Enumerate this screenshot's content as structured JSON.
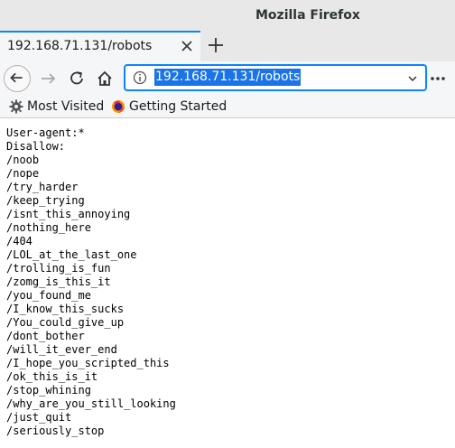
{
  "window": {
    "title": "Mozilla Firefox"
  },
  "tabs": [
    {
      "title": "192.168.71.131/robots"
    }
  ],
  "navbar": {
    "url": "192.168.71.131/robots"
  },
  "bookmarks": [
    {
      "label": "Most Visited",
      "icon": "gear-icon"
    },
    {
      "label": "Getting Started",
      "icon": "firefox-icon"
    }
  ],
  "content": {
    "lines": [
      "User-agent:*",
      "Disallow:",
      "/noob",
      "/nope",
      "/try_harder",
      "/keep_trying",
      "/isnt_this_annoying",
      "/nothing_here",
      "/404",
      "/LOL_at_the_last_one",
      "/trolling_is_fun",
      "/zomg_is_this_it",
      "/you_found_me",
      "/I_know_this_sucks",
      "/You_could_give_up",
      "/dont_bother",
      "/will_it_ever_end",
      "/I_hope_you_scripted_this",
      "/ok_this_is_it",
      "/stop_whining",
      "/why_are_you_still_looking",
      "/just_quit",
      "/seriously_stop"
    ]
  },
  "colors": {
    "accent": "#0a84ff",
    "selection": "#1a73e8"
  }
}
